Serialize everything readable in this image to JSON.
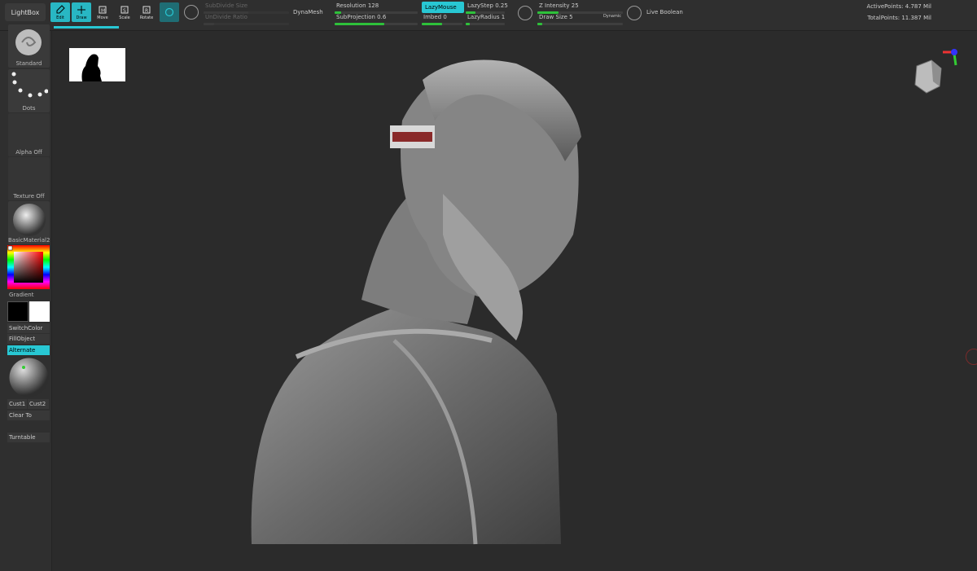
{
  "toolbar": {
    "lightbox": "LightBox",
    "tools": [
      {
        "label": "Edit",
        "icon": "edit-icon",
        "active": true
      },
      {
        "label": "Draw",
        "icon": "draw-icon",
        "active": true
      },
      {
        "label": "Move",
        "icon": "move-icon",
        "active": false
      },
      {
        "label": "Scale",
        "icon": "scale-icon",
        "active": false
      },
      {
        "label": "Rotate",
        "icon": "rotate-icon",
        "active": false
      }
    ],
    "subdivide_size": "SubDivide Size",
    "undivide_ratio": "UnDivide Ratio",
    "dynamesh": "DynaMesh",
    "resolution_label": "Resolution",
    "resolution_value": "128",
    "subprojection_label": "SubProjection",
    "subprojection_value": "0.6",
    "lazymouse": "LazyMouse",
    "imbed_label": "Imbed",
    "imbed_value": "0",
    "lazystep_label": "LazyStep",
    "lazystep_value": "0.25",
    "lazyradius_label": "LazyRadius",
    "lazyradius_value": "1",
    "zintensity_label": "Z Intensity",
    "zintensity_value": "25",
    "drawsize_label": "Draw Size",
    "drawsize_value": "5",
    "dynamic": "Dynamic",
    "live_boolean": "Live Boolean",
    "active_points": "ActivePoints: 4.787 Mil",
    "total_points": "TotalPoints: 11.387 Mil",
    "accent": "#28c7d3"
  },
  "shelf": {
    "brush": "Standard",
    "stroke": "Dots",
    "alpha": "Alpha Off",
    "texture": "Texture Off",
    "material": "BasicMaterial2",
    "gradient": "Gradient",
    "switchcolor": "SwitchColor",
    "fillobject": "FillObject",
    "alternate": "Alternate",
    "cust1": "Cust1",
    "cust2": "Cust2",
    "clearto": "Clear To",
    "turntable": "Turntable"
  }
}
